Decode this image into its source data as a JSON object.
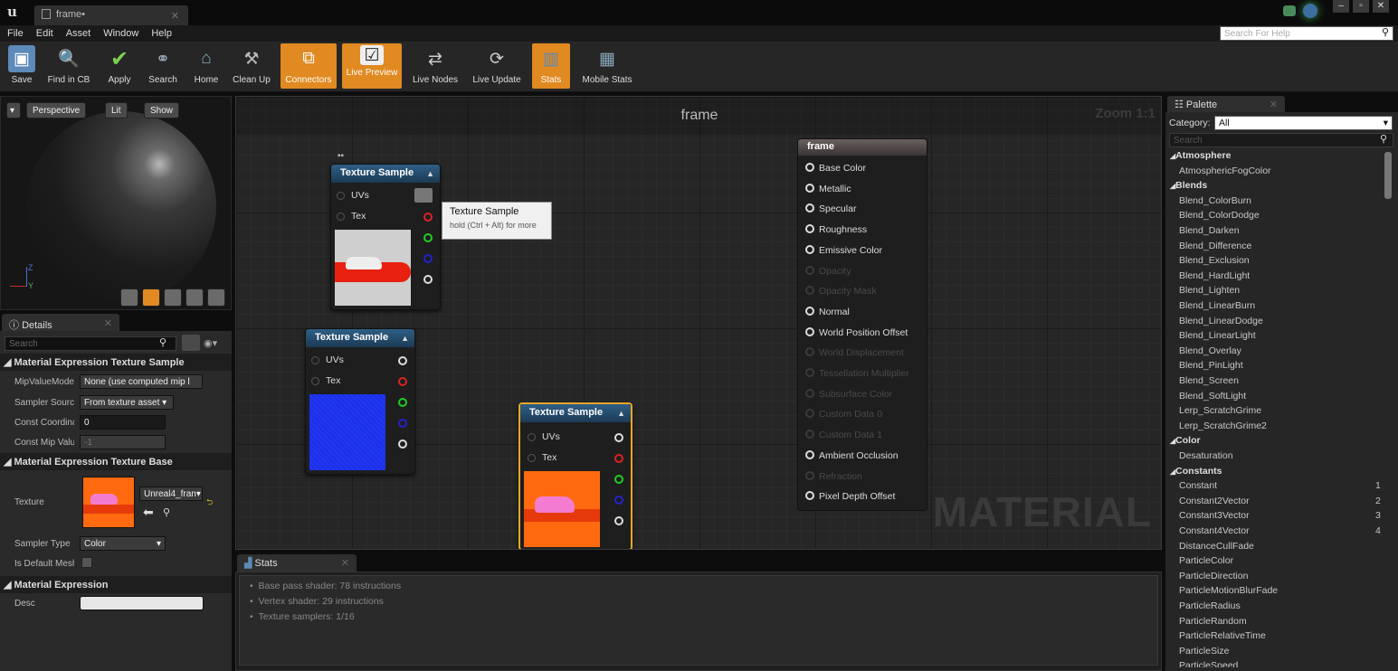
{
  "window": {
    "tab_title": "frame•",
    "controls": [
      "–",
      "▫",
      "✕"
    ]
  },
  "menu": [
    "File",
    "Edit",
    "Asset",
    "Window",
    "Help"
  ],
  "help_search": {
    "placeholder": "Search For Help"
  },
  "toolbar": [
    {
      "label": "Save",
      "icon": "save-icon",
      "active": false
    },
    {
      "label": "Find in CB",
      "icon": "magnifier-icon",
      "active": false
    },
    {
      "label": "Apply",
      "icon": "checkmark-icon",
      "active": false
    },
    {
      "label": "Search",
      "icon": "binoculars-icon",
      "active": false
    },
    {
      "label": "Home",
      "icon": "home-icon",
      "active": false
    },
    {
      "label": "Clean Up",
      "icon": "broom-icon",
      "active": false
    },
    {
      "label": "Connectors",
      "icon": "connectors-icon",
      "active": true
    },
    {
      "label": "Live Preview",
      "icon": "live-preview-icon",
      "active": true
    },
    {
      "label": "Live Nodes",
      "icon": "live-nodes-icon",
      "active": false
    },
    {
      "label": "Live Update",
      "icon": "live-update-icon",
      "active": false
    },
    {
      "label": "Stats",
      "icon": "stats-icon",
      "active": true
    },
    {
      "label": "Mobile Stats",
      "icon": "mobile-stats-icon",
      "active": false
    }
  ],
  "viewport": {
    "buttons": [
      "Perspective",
      "Lit",
      "Show"
    ],
    "axis_z": "Z",
    "axis_y": "Y"
  },
  "details": {
    "tab": "Details",
    "search_placeholder": "Search",
    "sections": [
      {
        "title": "Material Expression Texture Sample",
        "props": [
          {
            "label": "MipValueMode",
            "value": "None (use computed mip l"
          },
          {
            "label": "Sampler Source",
            "value": "From texture asset"
          },
          {
            "label": "Const Coordinate",
            "value": "0"
          },
          {
            "label": "Const Mip Value",
            "value": "-1"
          }
        ]
      },
      {
        "title": "Material Expression Texture Base",
        "props": [
          {
            "label": "Texture",
            "value": "Unreal4_fran"
          },
          {
            "label": "Sampler Type",
            "value": "Color"
          },
          {
            "label": "Is Default Mesh",
            "value": ""
          }
        ]
      },
      {
        "title": "Material Expression",
        "props": [
          {
            "label": "Desc",
            "value": ""
          }
        ]
      }
    ]
  },
  "graph": {
    "title": "frame",
    "zoom": "Zoom 1:1",
    "watermark": "MATERIAL",
    "nodes": [
      {
        "title": "Texture Sample",
        "inputs": [
          "UVs",
          "Tex"
        ]
      },
      {
        "title": "Texture Sample",
        "inputs": [
          "UVs",
          "Tex"
        ]
      },
      {
        "title": "Texture Sample",
        "inputs": [
          "UVs",
          "Tex"
        ]
      }
    ],
    "tooltip": {
      "title": "Texture Sample",
      "hint": "hold (Ctrl + Alt) for more"
    },
    "result": {
      "title": "frame",
      "pins": [
        {
          "label": "Base Color",
          "enabled": true
        },
        {
          "label": "Metallic",
          "enabled": true
        },
        {
          "label": "Specular",
          "enabled": true
        },
        {
          "label": "Roughness",
          "enabled": true
        },
        {
          "label": "Emissive Color",
          "enabled": true
        },
        {
          "label": "Opacity",
          "enabled": false
        },
        {
          "label": "Opacity Mask",
          "enabled": false
        },
        {
          "label": "Normal",
          "enabled": true
        },
        {
          "label": "World Position Offset",
          "enabled": true
        },
        {
          "label": "World Displacement",
          "enabled": false
        },
        {
          "label": "Tessellation Multiplier",
          "enabled": false
        },
        {
          "label": "Subsurface Color",
          "enabled": false
        },
        {
          "label": "Custom Data 0",
          "enabled": false
        },
        {
          "label": "Custom Data 1",
          "enabled": false
        },
        {
          "label": "Ambient Occlusion",
          "enabled": true
        },
        {
          "label": "Refraction",
          "enabled": false
        },
        {
          "label": "Pixel Depth Offset",
          "enabled": true
        }
      ]
    }
  },
  "stats": {
    "tab": "Stats",
    "lines": [
      "Base pass shader: 78 instructions",
      "Vertex shader: 29 instructions",
      "Texture samplers: 1/16"
    ]
  },
  "palette": {
    "tab": "Palette",
    "category_label": "Category:",
    "category_value": "All",
    "search_placeholder": "Search",
    "rows": [
      {
        "text": "Atmosphere",
        "kind": "cat"
      },
      {
        "text": "AtmosphericFogColor",
        "kind": "item"
      },
      {
        "text": "Blends",
        "kind": "cat"
      },
      {
        "text": "Blend_ColorBurn",
        "kind": "item"
      },
      {
        "text": "Blend_ColorDodge",
        "kind": "item"
      },
      {
        "text": "Blend_Darken",
        "kind": "item"
      },
      {
        "text": "Blend_Difference",
        "kind": "item"
      },
      {
        "text": "Blend_Exclusion",
        "kind": "item"
      },
      {
        "text": "Blend_HardLight",
        "kind": "item"
      },
      {
        "text": "Blend_Lighten",
        "kind": "item"
      },
      {
        "text": "Blend_LinearBurn",
        "kind": "item"
      },
      {
        "text": "Blend_LinearDodge",
        "kind": "item"
      },
      {
        "text": "Blend_LinearLight",
        "kind": "item"
      },
      {
        "text": "Blend_Overlay",
        "kind": "item"
      },
      {
        "text": "Blend_PinLight",
        "kind": "item"
      },
      {
        "text": "Blend_Screen",
        "kind": "item"
      },
      {
        "text": "Blend_SoftLight",
        "kind": "item"
      },
      {
        "text": "Lerp_ScratchGrime",
        "kind": "item"
      },
      {
        "text": "Lerp_ScratchGrime2",
        "kind": "item"
      },
      {
        "text": "Color",
        "kind": "cat"
      },
      {
        "text": "Desaturation",
        "kind": "item"
      },
      {
        "text": "Constants",
        "kind": "cat"
      },
      {
        "text": "Constant",
        "kind": "item",
        "hotkey": "1"
      },
      {
        "text": "Constant2Vector",
        "kind": "item",
        "hotkey": "2"
      },
      {
        "text": "Constant3Vector",
        "kind": "item",
        "hotkey": "3"
      },
      {
        "text": "Constant4Vector",
        "kind": "item",
        "hotkey": "4"
      },
      {
        "text": "DistanceCullFade",
        "kind": "item"
      },
      {
        "text": "ParticleColor",
        "kind": "item"
      },
      {
        "text": "ParticleDirection",
        "kind": "item"
      },
      {
        "text": "ParticleMotionBlurFade",
        "kind": "item"
      },
      {
        "text": "ParticleRadius",
        "kind": "item"
      },
      {
        "text": "ParticleRandom",
        "kind": "item"
      },
      {
        "text": "ParticleRelativeTime",
        "kind": "item"
      },
      {
        "text": "ParticleSize",
        "kind": "item"
      },
      {
        "text": "ParticleSpeed",
        "kind": "item"
      }
    ]
  }
}
